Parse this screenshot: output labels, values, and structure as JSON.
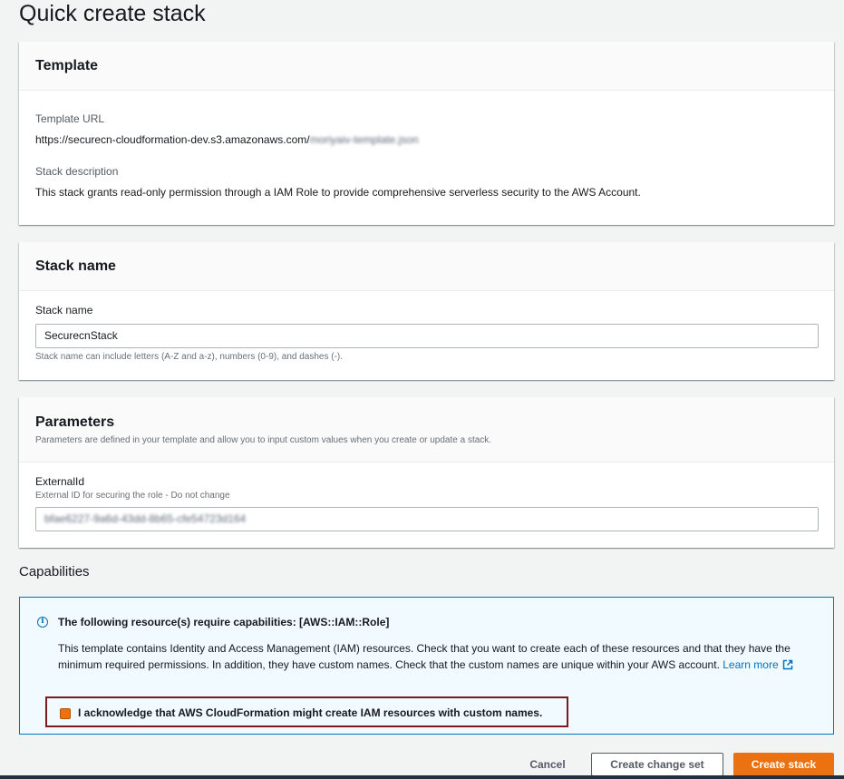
{
  "page": {
    "title": "Quick create stack"
  },
  "template_panel": {
    "title": "Template",
    "url_label": "Template URL",
    "url_value": "https://securecn-cloudformation-dev.s3.amazonaws.com/",
    "url_value_obscured": "moriyaiv-template.json",
    "description_label": "Stack description",
    "description_value": "This stack grants read-only permission through a IAM Role to provide comprehensive serverless security to the AWS Account."
  },
  "stack_name_panel": {
    "title": "Stack name",
    "field_label": "Stack name",
    "field_value": "SecurecnStack",
    "hint": "Stack name can include letters (A-Z and a-z), numbers (0-9), and dashes (-)."
  },
  "parameters_panel": {
    "title": "Parameters",
    "subtitle": "Parameters are defined in your template and allow you to input custom values when you create or update a stack.",
    "param_label": "ExternalId",
    "param_description": "External ID for securing the role - Do not change",
    "param_value": "bfae6227-9a6d-43dd-8b65-cfe54723d164"
  },
  "capabilities": {
    "title": "Capabilities",
    "heading": "The following resource(s) require capabilities: [AWS::IAM::Role]",
    "text": "This template contains Identity and Access Management (IAM) resources. Check that you want to create each of these resources and that they have the minimum required permissions. In addition, they have custom names. Check that the custom names are unique within your AWS account.",
    "learn_more": "Learn more",
    "ack_label": "I acknowledge that AWS CloudFormation might create IAM resources with custom names.",
    "ack_checked": true
  },
  "footer": {
    "cancel": "Cancel",
    "create_change_set": "Create change set",
    "create_stack": "Create stack"
  },
  "icons": {
    "info": "info-icon",
    "external_link": "external-link-icon"
  },
  "colors": {
    "primary_orange": "#ec7211",
    "link_blue": "#0073bb",
    "info_bg": "#f1faff",
    "highlight_border": "#7d1a1f"
  }
}
